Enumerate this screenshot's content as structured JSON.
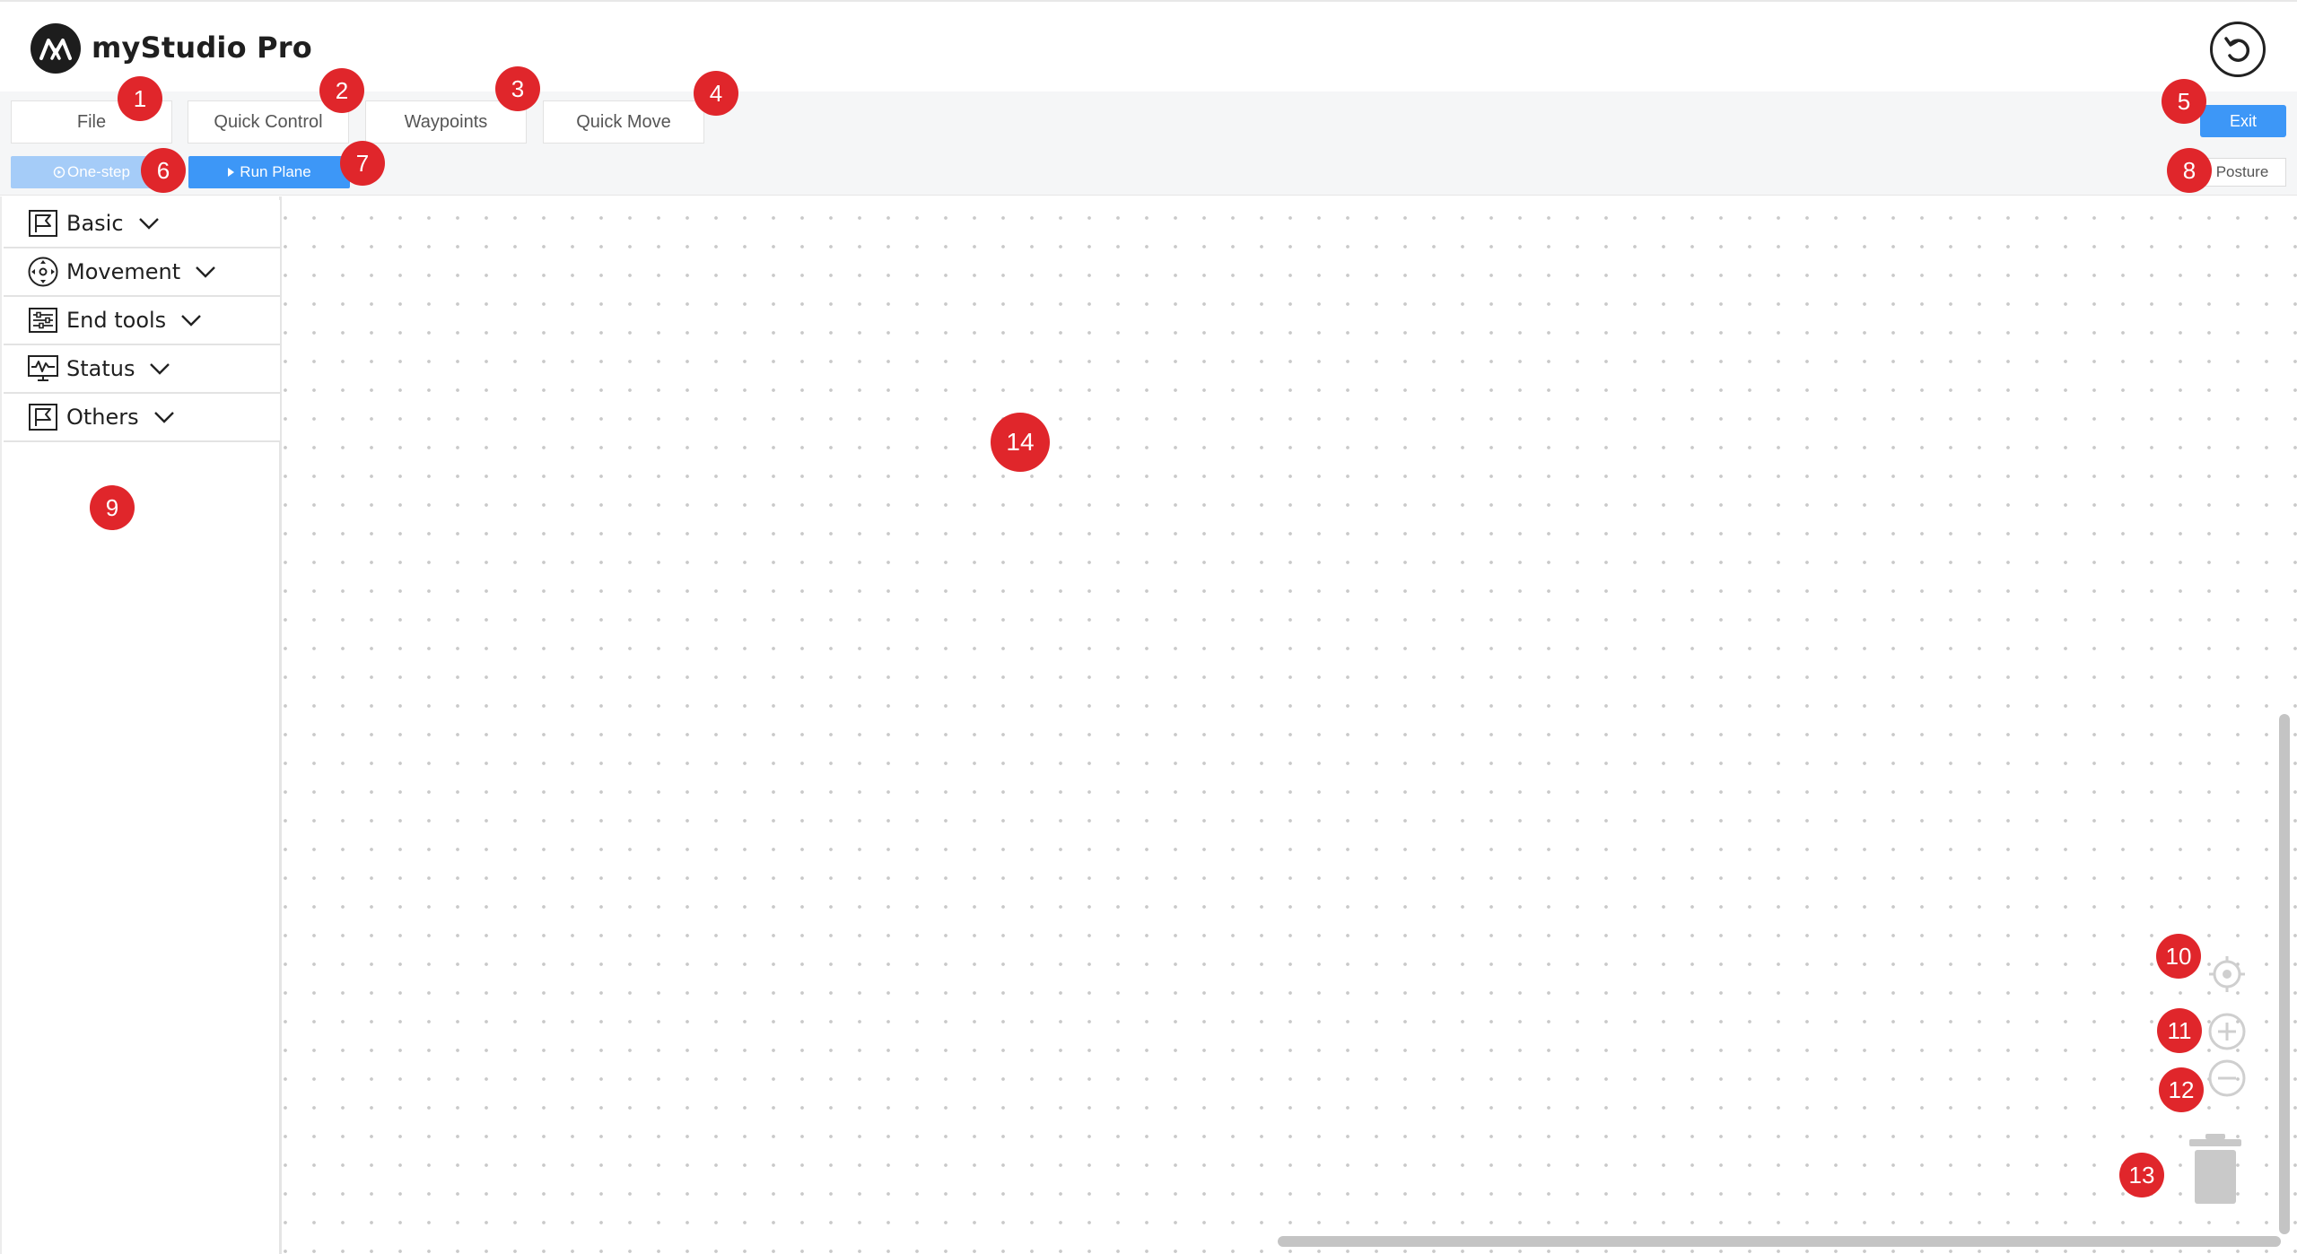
{
  "app": {
    "title": "myStudio Pro"
  },
  "toolbar": {
    "tabs": [
      "File",
      "Quick Control",
      "Waypoints",
      "Quick Move"
    ],
    "exit_label": "Exit",
    "onestep_label": "One-step",
    "runplane_label": "Run Plane",
    "posture_label": "Posture"
  },
  "sidebar": {
    "categories": [
      {
        "label": "Basic",
        "icon": "flag-icon"
      },
      {
        "label": "Movement",
        "icon": "move-icon"
      },
      {
        "label": "End tools",
        "icon": "sliders-icon"
      },
      {
        "label": "Status",
        "icon": "monitor-wave-icon"
      },
      {
        "label": "Others",
        "icon": "flag-icon"
      }
    ]
  },
  "canvas_controls": [
    "center-target-icon",
    "zoom-in-icon",
    "zoom-out-icon",
    "trash-icon"
  ],
  "annotations": [
    "1",
    "2",
    "3",
    "4",
    "5",
    "6",
    "7",
    "8",
    "9",
    "10",
    "11",
    "12",
    "13",
    "14"
  ],
  "colors": {
    "accent": "#3d97f7",
    "accent_light": "#a5ccf8",
    "badge": "#e0262b"
  }
}
